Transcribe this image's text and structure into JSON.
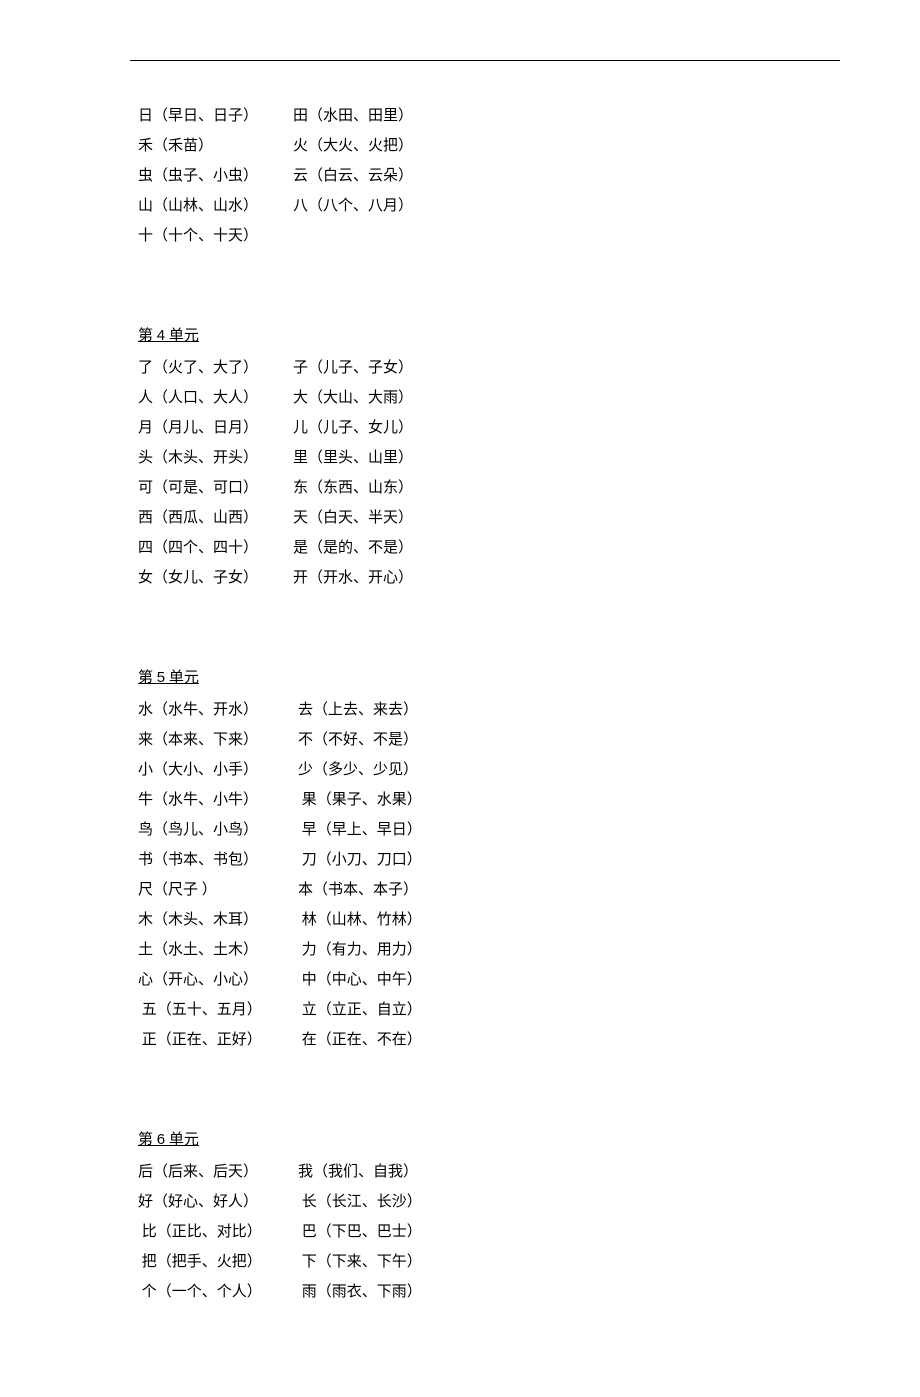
{
  "sections": [
    {
      "title": null,
      "rows": [
        {
          "left": "日（早日、日子）",
          "right": "田（水田、田里）"
        },
        {
          "left": "禾（禾苗）",
          "right": "火（大火、火把）"
        },
        {
          "left": "虫（虫子、小虫）",
          "right": "云（白云、云朵）"
        },
        {
          "left": "山（山林、山水）",
          "right": "八（八个、八月）"
        },
        {
          "left": "十（十个、十天）",
          "right": ""
        }
      ]
    },
    {
      "title_prefix": "第 ",
      "title_num": "4",
      "title_suffix": " 单元",
      "rows": [
        {
          "left": "了（火了、大了）",
          "right": "子（儿子、子女）"
        },
        {
          "left": "人（人口、大人）",
          "right": "大（大山、大雨）"
        },
        {
          "left": "月（月儿、日月）",
          "right": "儿（儿子、女儿）"
        },
        {
          "left": "头（木头、开头）",
          "right": "里（里头、山里）"
        },
        {
          "left": "可（可是、可口）",
          "right": "东（东西、山东）"
        },
        {
          "left": "西（西瓜、山西）",
          "right": "天（白天、半天）"
        },
        {
          "left": "四（四个、四十）",
          "right": "是（是的、不是）"
        },
        {
          "left": "女（女儿、子女）",
          "right": "开（开水、开心）"
        }
      ]
    },
    {
      "title_prefix": "第 ",
      "title_num": "5",
      "title_suffix": " 单元",
      "class": "u5",
      "rows": [
        {
          "left": "水（水牛、开水）",
          "right": "去（上去、来去）"
        },
        {
          "left": "来（本来、下来）",
          "right": "不（不好、不是）"
        },
        {
          "left": "小（大小、小手）",
          "right": "少（多少、少见）"
        },
        {
          "left": "牛（水牛、小牛）",
          "right": " 果（果子、水果）"
        },
        {
          "left": "鸟（鸟儿、小鸟）",
          "right": " 早（早上、早日）"
        },
        {
          "left": "书（书本、书包）",
          "right": " 刀（小刀、刀口）"
        },
        {
          "left": "尺（尺子 ）",
          "right": "本（书本、本子）"
        },
        {
          "left": "木（木头、木耳）",
          "right": " 林（山林、竹林）"
        },
        {
          "left": "土（水土、土木）",
          "right": " 力（有力、用力）"
        },
        {
          "left": "心（开心、小心）",
          "right": " 中（中心、中午）"
        },
        {
          "left": " 五（五十、五月）",
          "right": " 立（立正、自立）"
        },
        {
          "left": " 正（正在、正好）",
          "right": " 在（正在、不在）"
        }
      ]
    },
    {
      "title_prefix": "第 ",
      "title_num": "6",
      "title_suffix": " 单元",
      "class": "u6",
      "rows": [
        {
          "left": "后（后来、后天）",
          "right": "我（我们、自我）"
        },
        {
          "left": "好（好心、好人）",
          "right": " 长（长江、长沙）"
        },
        {
          "left": " 比（正比、对比）",
          "right": " 巴（下巴、巴士）"
        },
        {
          "left": " 把（把手、火把）",
          "right": " 下（下来、下午）"
        },
        {
          "left": " 个（一个、个人）",
          "right": " 雨（雨衣、下雨）"
        }
      ]
    }
  ]
}
